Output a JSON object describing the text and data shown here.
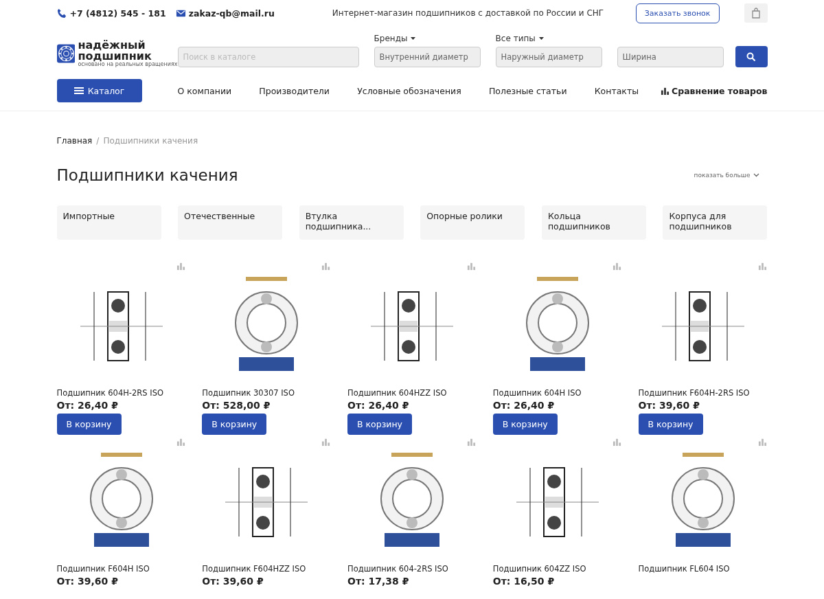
{
  "topbar": {
    "phone": "+7 (4812) 545 - 181",
    "email": "zakaz-qb@mail.ru",
    "tagline": "Интернет-магазин подшипников с доставкой по России и СНГ",
    "callback_button": "Заказать звонок"
  },
  "logo": {
    "line1": "надёжный",
    "line2": "подшипник",
    "slogan": "основано на реальных вращениях"
  },
  "search": {
    "placeholder": "Поиск в каталоге"
  },
  "filters": [
    {
      "label": "Бренды",
      "placeholder": "Внутренний диаметр"
    },
    {
      "label": "Все типы",
      "placeholder": "Наружный диаметр"
    },
    {
      "placeholder": "Ширина"
    }
  ],
  "catalog_button": "Каталог",
  "nav": [
    "О компании",
    "Производители",
    "Условные обозначения",
    "Полезные статьи",
    "Контакты"
  ],
  "compare_link": "Сравнение товаров",
  "breadcrumbs": [
    "Главная",
    "Подшипники качения"
  ],
  "breadcrumb_separator": "/",
  "title": "Подшипники качения",
  "show_more": "показать больше",
  "categories": [
    "Импортные",
    "Отечественные",
    "Втулка подшипника...",
    "Опорные ролики",
    "Кольца подшипников",
    "Корпуса для подшипников"
  ],
  "products": [
    {
      "name": "Подшипник 604H-2RS ISO",
      "price": "От: 26,40 ₽",
      "button": "В корзину"
    },
    {
      "name": "Подшипник 30307 ISO",
      "price": "От: 528,00 ₽",
      "button": "В корзину"
    },
    {
      "name": "Подшипник 604HZZ ISO",
      "price": "От: 26,40 ₽",
      "button": "В корзину"
    },
    {
      "name": "Подшипник 604H ISO",
      "price": "От: 26,40 ₽",
      "button": "В корзину"
    },
    {
      "name": "Подшипник F604H-2RS ISO",
      "price": "От: 39,60 ₽",
      "button": "В корзину"
    },
    {
      "name": "Подшипник F604H ISO",
      "price": "От: 39,60 ₽"
    },
    {
      "name": "Подшипник F604HZZ ISO",
      "price": "От: 39,60 ₽"
    },
    {
      "name": "Подшипник 604-2RS ISO",
      "price": "От: 17,38 ₽"
    },
    {
      "name": "Подшипник 604ZZ ISO",
      "price": "От: 16,50 ₽"
    },
    {
      "name": "Подшипник FL604 ISO"
    }
  ]
}
